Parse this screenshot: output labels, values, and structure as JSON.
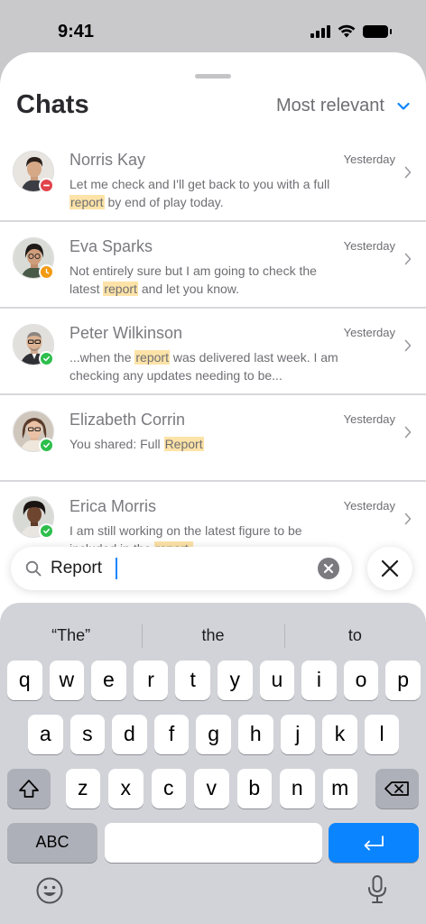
{
  "status": {
    "time": "9:41"
  },
  "header": {
    "title": "Chats",
    "sort_label": "Most relevant"
  },
  "colors": {
    "accent": "#0A84FF",
    "highlight": "#FDE3A7",
    "busy": "#E0434B",
    "away": "#F29A12",
    "online": "#2DBE4C"
  },
  "chats": [
    {
      "name": "Norris Kay",
      "time": "Yesterday",
      "status": "busy",
      "preview": {
        "before": "Let me check and I'll get back to you with a full ",
        "match": "report",
        "after": " by end of play today."
      }
    },
    {
      "name": "Eva Sparks",
      "time": "Yesterday",
      "status": "away",
      "preview": {
        "before": "Not entirely sure but I am going to check the latest ",
        "match": "report",
        "after": " and let you know."
      }
    },
    {
      "name": "Peter Wilkinson",
      "time": "Yesterday",
      "status": "online",
      "preview": {
        "before": "...when the ",
        "match": "report",
        "after": " was delivered last week. I am checking any updates needing to be..."
      }
    },
    {
      "name": "Elizabeth Corrin",
      "time": "Yesterday",
      "status": "online",
      "preview": {
        "before": "You shared: Full ",
        "match": "Report",
        "after": ""
      }
    },
    {
      "name": "Erica Morris",
      "time": "Yesterday",
      "status": "online",
      "preview": {
        "before": "I am still working on the latest figure to be included in the ",
        "match": "report.",
        "after": ""
      }
    }
  ],
  "search": {
    "value": "Report"
  },
  "keyboard": {
    "suggestions": [
      "“The”",
      "the",
      "to"
    ],
    "row1": [
      "q",
      "w",
      "e",
      "r",
      "t",
      "y",
      "u",
      "i",
      "o",
      "p"
    ],
    "row2": [
      "a",
      "s",
      "d",
      "f",
      "g",
      "h",
      "j",
      "k",
      "l"
    ],
    "row3": [
      "z",
      "x",
      "c",
      "v",
      "b",
      "n",
      "m"
    ],
    "abc_label": "ABC"
  }
}
